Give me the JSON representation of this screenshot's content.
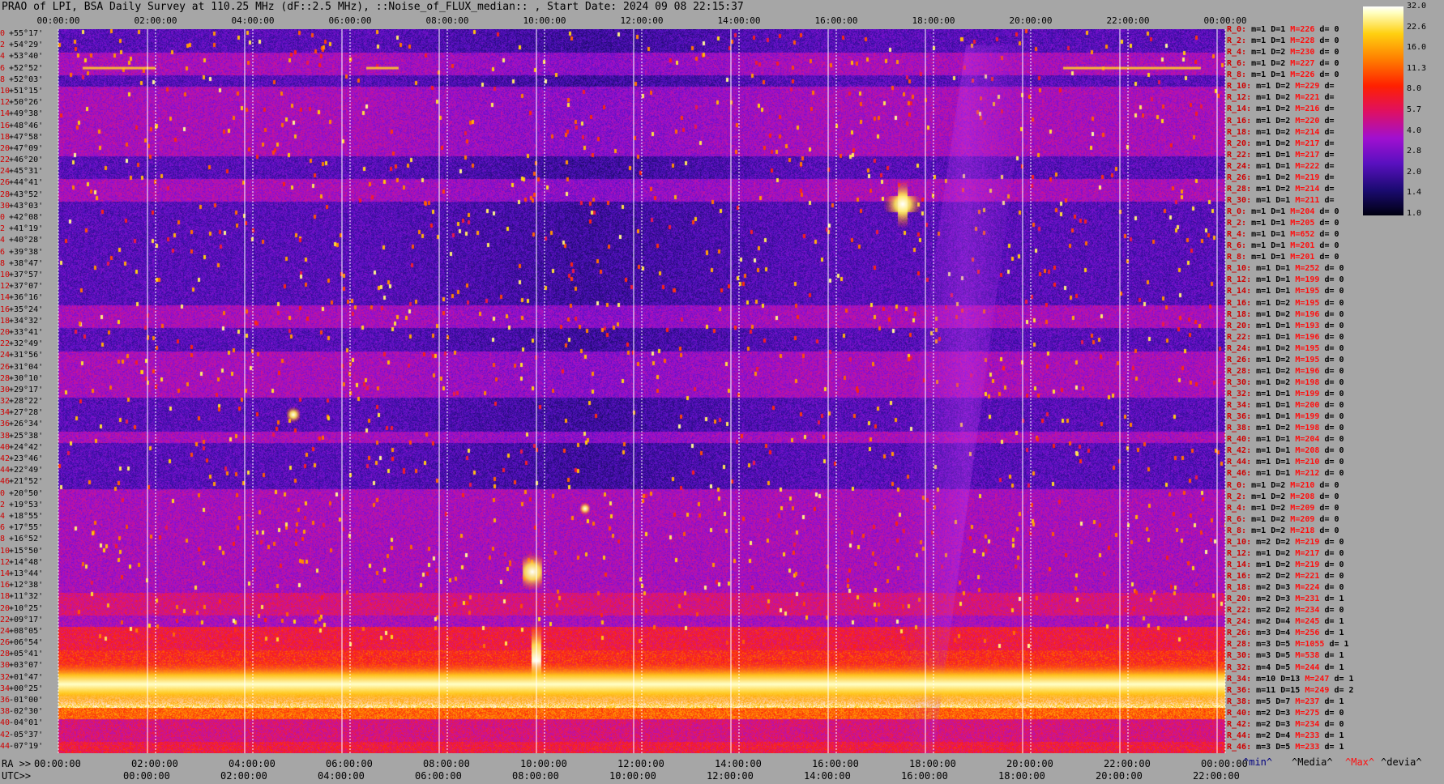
{
  "title": "PRAO of LPI, BSA Daily Survey at 110.25 MHz (dF::2.5 MHz), ::Noise_of_FLUX_median:: , Start Date: 2024 09 08 22:15:37",
  "top_ticks": [
    "00:00:00",
    "02:00:00",
    "04:00:00",
    "06:00:00",
    "08:00:00",
    "10:00:00",
    "12:00:00",
    "14:00:00",
    "16:00:00",
    "18:00:00",
    "20:00:00",
    "22:00:00",
    "00:00:00"
  ],
  "bottom_ra_prefix": "RA >>",
  "bottom_ra_ticks": [
    "00:00:00",
    "02:00:00",
    "04:00:00",
    "06:00:00",
    "08:00:00",
    "10:00:00",
    "12:00:00",
    "14:00:00",
    "16:00:00",
    "18:00:00",
    "20:00:00",
    "22:00:00",
    "00:00:00"
  ],
  "bottom_utc_prefix": "UTC>>",
  "bottom_utc_ticks": [
    "00:00:00",
    "02:00:00",
    "04:00:00",
    "06:00:00",
    "08:00:00",
    "10:00:00",
    "12:00:00",
    "14:00:00",
    "16:00:00",
    "18:00:00",
    "20:00:00",
    "22:00:00"
  ],
  "column_headers": [
    {
      "text": "^min^",
      "color": "#000080"
    },
    {
      "text": "^Media^",
      "color": "#000000"
    },
    {
      "text": "^Max^",
      "color": "#ff1010"
    },
    {
      "text": "^devia^",
      "color": "#000000"
    }
  ],
  "legend_values": [
    "32.0",
    "22.6",
    "16.0",
    "11.3",
    "8.0",
    "5.7",
    "4.0",
    "2.8",
    "2.0",
    "1.4",
    "1.0"
  ],
  "declinations": [
    {
      "i": "0",
      "d": "+55°17'"
    },
    {
      "i": "2",
      "d": "+54°29'"
    },
    {
      "i": "4",
      "d": "+53°40'"
    },
    {
      "i": "6",
      "d": "+52°52'"
    },
    {
      "i": "8",
      "d": "+52°03'"
    },
    {
      "i": "10",
      "d": "+51°15'"
    },
    {
      "i": "12",
      "d": "+50°26'"
    },
    {
      "i": "14",
      "d": "+49°38'"
    },
    {
      "i": "16",
      "d": "+48°46'"
    },
    {
      "i": "18",
      "d": "+47°58'"
    },
    {
      "i": "20",
      "d": "+47°09'"
    },
    {
      "i": "22",
      "d": "+46°20'"
    },
    {
      "i": "24",
      "d": "+45°31'"
    },
    {
      "i": "26",
      "d": "+44°41'"
    },
    {
      "i": "28",
      "d": "+43°52'"
    },
    {
      "i": "30",
      "d": "+43°03'"
    },
    {
      "i": "0",
      "d": "+42°08'"
    },
    {
      "i": "2",
      "d": "+41°19'"
    },
    {
      "i": "4",
      "d": "+40°28'"
    },
    {
      "i": "6",
      "d": "+39°38'"
    },
    {
      "i": "8",
      "d": "+38°47'"
    },
    {
      "i": "10",
      "d": "+37°57'"
    },
    {
      "i": "12",
      "d": "+37°07'"
    },
    {
      "i": "14",
      "d": "+36°16'"
    },
    {
      "i": "16",
      "d": "+35°24'"
    },
    {
      "i": "18",
      "d": "+34°32'"
    },
    {
      "i": "20",
      "d": "+33°41'"
    },
    {
      "i": "22",
      "d": "+32°49'"
    },
    {
      "i": "24",
      "d": "+31°56'"
    },
    {
      "i": "26",
      "d": "+31°04'"
    },
    {
      "i": "28",
      "d": "+30°10'"
    },
    {
      "i": "30",
      "d": "+29°17'"
    },
    {
      "i": "32",
      "d": "+28°22'"
    },
    {
      "i": "34",
      "d": "+27°28'"
    },
    {
      "i": "36",
      "d": "+26°34'"
    },
    {
      "i": "38",
      "d": "+25°38'"
    },
    {
      "i": "40",
      "d": "+24°42'"
    },
    {
      "i": "42",
      "d": "+23°46'"
    },
    {
      "i": "44",
      "d": "+22°49'"
    },
    {
      "i": "46",
      "d": "+21°52'"
    },
    {
      "i": "0",
      "d": "+20°50'"
    },
    {
      "i": "2",
      "d": "+19°53'"
    },
    {
      "i": "4",
      "d": "+18°55'"
    },
    {
      "i": "6",
      "d": "+17°55'"
    },
    {
      "i": "8",
      "d": "+16°52'"
    },
    {
      "i": "10",
      "d": "+15°50'"
    },
    {
      "i": "12",
      "d": "+14°48'"
    },
    {
      "i": "14",
      "d": "+13°44'"
    },
    {
      "i": "16",
      "d": "+12°38'"
    },
    {
      "i": "18",
      "d": "+11°32'"
    },
    {
      "i": "20",
      "d": "+10°25'"
    },
    {
      "i": "22",
      "d": "+09°17'"
    },
    {
      "i": "24",
      "d": "+08°05'"
    },
    {
      "i": "26",
      "d": "+06°54'"
    },
    {
      "i": "28",
      "d": "+05°41'"
    },
    {
      "i": "30",
      "d": "+03°07'"
    },
    {
      "i": "32",
      "d": "+01°47'"
    },
    {
      "i": "34",
      "d": "+00°25'"
    },
    {
      "i": "36",
      "d": "-01°00'"
    },
    {
      "i": "38",
      "d": "-02°30'"
    },
    {
      "i": "40",
      "d": "-04°01'"
    },
    {
      "i": "42",
      "d": "-05°37'"
    },
    {
      "i": "44",
      "d": "-07°19'"
    }
  ],
  "stats": [
    {
      "r": "R_0:",
      "m": "m=1",
      "D": "D=1",
      "M": "M=226",
      "d": "d= 0"
    },
    {
      "r": "R_2:",
      "m": "m=1",
      "D": "D=1",
      "M": "M=228",
      "d": "d= 0"
    },
    {
      "r": "R_4:",
      "m": "m=1",
      "D": "D=2",
      "M": "M=230",
      "d": "d= 0"
    },
    {
      "r": "R_6:",
      "m": "m=1",
      "D": "D=2",
      "M": "M=227",
      "d": "d= 0"
    },
    {
      "r": "R_8:",
      "m": "m=1",
      "D": "D=1",
      "M": "M=226",
      "d": "d= 0"
    },
    {
      "r": "R_10:",
      "m": "m=1",
      "D": "D=2",
      "M": "M=229",
      "d": "d="
    },
    {
      "r": "R_12:",
      "m": "m=1",
      "D": "D=2",
      "M": "M=221",
      "d": "d="
    },
    {
      "r": "R_14:",
      "m": "m=1",
      "D": "D=2",
      "M": "M=216",
      "d": "d="
    },
    {
      "r": "R_16:",
      "m": "m=1",
      "D": "D=2",
      "M": "M=220",
      "d": "d="
    },
    {
      "r": "R_18:",
      "m": "m=1",
      "D": "D=2",
      "M": "M=214",
      "d": "d="
    },
    {
      "r": "R_20:",
      "m": "m=1",
      "D": "D=2",
      "M": "M=217",
      "d": "d="
    },
    {
      "r": "R_22:",
      "m": "m=1",
      "D": "D=1",
      "M": "M=217",
      "d": "d="
    },
    {
      "r": "R_24:",
      "m": "m=1",
      "D": "D=1",
      "M": "M=222",
      "d": "d="
    },
    {
      "r": "R_26:",
      "m": "m=1",
      "D": "D=2",
      "M": "M=219",
      "d": "d="
    },
    {
      "r": "R_28:",
      "m": "m=1",
      "D": "D=2",
      "M": "M=214",
      "d": "d="
    },
    {
      "r": "R_30:",
      "m": "m=1",
      "D": "D=1",
      "M": "M=211",
      "d": "d="
    },
    {
      "r": "R_0:",
      "m": "m=1",
      "D": "D=1",
      "M": "M=204",
      "d": "d= 0"
    },
    {
      "r": "R_2:",
      "m": "m=1",
      "D": "D=1",
      "M": "M=205",
      "d": "d= 0"
    },
    {
      "r": "R_4:",
      "m": "m=1",
      "D": "D=1",
      "M": "M=652",
      "d": "d= 0"
    },
    {
      "r": "R_6:",
      "m": "m=1",
      "D": "D=1",
      "M": "M=201",
      "d": "d= 0"
    },
    {
      "r": "R_8:",
      "m": "m=1",
      "D": "D=1",
      "M": "M=201",
      "d": "d= 0"
    },
    {
      "r": "R_10:",
      "m": "m=1",
      "D": "D=1",
      "M": "M=252",
      "d": "d= 0"
    },
    {
      "r": "R_12:",
      "m": "m=1",
      "D": "D=1",
      "M": "M=199",
      "d": "d= 0"
    },
    {
      "r": "R_14:",
      "m": "m=1",
      "D": "D=1",
      "M": "M=195",
      "d": "d= 0"
    },
    {
      "r": "R_16:",
      "m": "m=1",
      "D": "D=2",
      "M": "M=195",
      "d": "d= 0"
    },
    {
      "r": "R_18:",
      "m": "m=1",
      "D": "D=2",
      "M": "M=196",
      "d": "d= 0"
    },
    {
      "r": "R_20:",
      "m": "m=1",
      "D": "D=1",
      "M": "M=193",
      "d": "d= 0"
    },
    {
      "r": "R_22:",
      "m": "m=1",
      "D": "D=1",
      "M": "M=196",
      "d": "d= 0"
    },
    {
      "r": "R_24:",
      "m": "m=1",
      "D": "D=2",
      "M": "M=195",
      "d": "d= 0"
    },
    {
      "r": "R_26:",
      "m": "m=1",
      "D": "D=2",
      "M": "M=195",
      "d": "d= 0"
    },
    {
      "r": "R_28:",
      "m": "m=1",
      "D": "D=2",
      "M": "M=196",
      "d": "d= 0"
    },
    {
      "r": "R_30:",
      "m": "m=1",
      "D": "D=2",
      "M": "M=198",
      "d": "d= 0"
    },
    {
      "r": "R_32:",
      "m": "m=1",
      "D": "D=1",
      "M": "M=199",
      "d": "d= 0"
    },
    {
      "r": "R_34:",
      "m": "m=1",
      "D": "D=1",
      "M": "M=200",
      "d": "d= 0"
    },
    {
      "r": "R_36:",
      "m": "m=1",
      "D": "D=1",
      "M": "M=199",
      "d": "d= 0"
    },
    {
      "r": "R_38:",
      "m": "m=1",
      "D": "D=2",
      "M": "M=198",
      "d": "d= 0"
    },
    {
      "r": "R_40:",
      "m": "m=1",
      "D": "D=1",
      "M": "M=204",
      "d": "d= 0"
    },
    {
      "r": "R_42:",
      "m": "m=1",
      "D": "D=1",
      "M": "M=208",
      "d": "d= 0"
    },
    {
      "r": "R_44:",
      "m": "m=1",
      "D": "D=1",
      "M": "M=210",
      "d": "d= 0"
    },
    {
      "r": "R_46:",
      "m": "m=1",
      "D": "D=1",
      "M": "M=212",
      "d": "d= 0"
    },
    {
      "r": "R_0:",
      "m": "m=1",
      "D": "D=2",
      "M": "M=210",
      "d": "d= 0"
    },
    {
      "r": "R_2:",
      "m": "m=1",
      "D": "D=2",
      "M": "M=208",
      "d": "d= 0"
    },
    {
      "r": "R_4:",
      "m": "m=1",
      "D": "D=2",
      "M": "M=209",
      "d": "d= 0"
    },
    {
      "r": "R_6:",
      "m": "m=1",
      "D": "D=2",
      "M": "M=209",
      "d": "d= 0"
    },
    {
      "r": "R_8:",
      "m": "m=1",
      "D": "D=2",
      "M": "M=218",
      "d": "d= 0"
    },
    {
      "r": "R_10:",
      "m": "m=2",
      "D": "D=2",
      "M": "M=219",
      "d": "d= 0"
    },
    {
      "r": "R_12:",
      "m": "m=1",
      "D": "D=2",
      "M": "M=217",
      "d": "d= 0"
    },
    {
      "r": "R_14:",
      "m": "m=1",
      "D": "D=2",
      "M": "M=219",
      "d": "d= 0"
    },
    {
      "r": "R_16:",
      "m": "m=2",
      "D": "D=2",
      "M": "M=221",
      "d": "d= 0"
    },
    {
      "r": "R_18:",
      "m": "m=2",
      "D": "D=3",
      "M": "M=224",
      "d": "d= 0"
    },
    {
      "r": "R_20:",
      "m": "m=2",
      "D": "D=3",
      "M": "M=231",
      "d": "d= 1"
    },
    {
      "r": "R_22:",
      "m": "m=2",
      "D": "D=2",
      "M": "M=234",
      "d": "d= 0"
    },
    {
      "r": "R_24:",
      "m": "m=2",
      "D": "D=4",
      "M": "M=245",
      "d": "d= 1"
    },
    {
      "r": "R_26:",
      "m": "m=3",
      "D": "D=4",
      "M": "M=256",
      "d": "d= 1"
    },
    {
      "r": "R_28:",
      "m": "m=3",
      "D": "D=5",
      "M": "M=1055",
      "d": "d= 1"
    },
    {
      "r": "R_30:",
      "m": "m=3",
      "D": "D=5",
      "M": "M=538",
      "d": "d= 1"
    },
    {
      "r": "R_32:",
      "m": "m=4",
      "D": "D=5",
      "M": "M=244",
      "d": "d= 1"
    },
    {
      "r": "R_34:",
      "m": "m=10",
      "D": "D=13",
      "M": "M=247",
      "d": "d= 1"
    },
    {
      "r": "R_36:",
      "m": "m=11",
      "D": "D=15",
      "M": "M=249",
      "d": "d= 2"
    },
    {
      "r": "R_38:",
      "m": "m=5",
      "D": "D=7",
      "M": "M=237",
      "d": "d= 1"
    },
    {
      "r": "R_40:",
      "m": "m=2",
      "D": "D=3",
      "M": "M=275",
      "d": "d= 0"
    },
    {
      "r": "R_42:",
      "m": "m=2",
      "D": "D=3",
      "M": "M=234",
      "d": "d= 0"
    },
    {
      "r": "R_44:",
      "m": "m=2",
      "D": "D=4",
      "M": "M=233",
      "d": "d= 1"
    },
    {
      "r": "R_46:",
      "m": "m=3",
      "D": "D=5",
      "M": "M=233",
      "d": "d= 1"
    }
  ],
  "colors": {
    "background": "#a6a6a6",
    "grid": "#ffffff",
    "label_red": "#d00000",
    "max_red": "#ff1010"
  },
  "chart_data": {
    "type": "heatmap",
    "title": "PRAO of LPI, BSA Daily Survey at 110.25 MHz (dF::2.5 MHz), ::Noise_of_FLUX_median:: , Start Date: 2024 09 08 22:15:37",
    "x_axis": "RA (hh:mm:ss), 00:00:00 to 24:00:00",
    "y_axis": "Declination, +55°17' to -07°19'",
    "colorscale": [
      "1.0",
      "1.4",
      "2.0",
      "2.8",
      "4.0",
      "5.7",
      "8.0",
      "11.3",
      "16.0",
      "22.6",
      "32.0"
    ],
    "colorscale_log2": true,
    "bright_band_declinations": [
      "+01°47'",
      "+00°25'"
    ],
    "notable_max": [
      {
        "row": "R_4:",
        "dec": "+40°28'",
        "M": 652
      },
      {
        "row": "R_28:",
        "dec": "+05°41'",
        "M": 1055
      },
      {
        "row": "R_30:",
        "dec": "+03°07'",
        "M": 538
      }
    ]
  }
}
